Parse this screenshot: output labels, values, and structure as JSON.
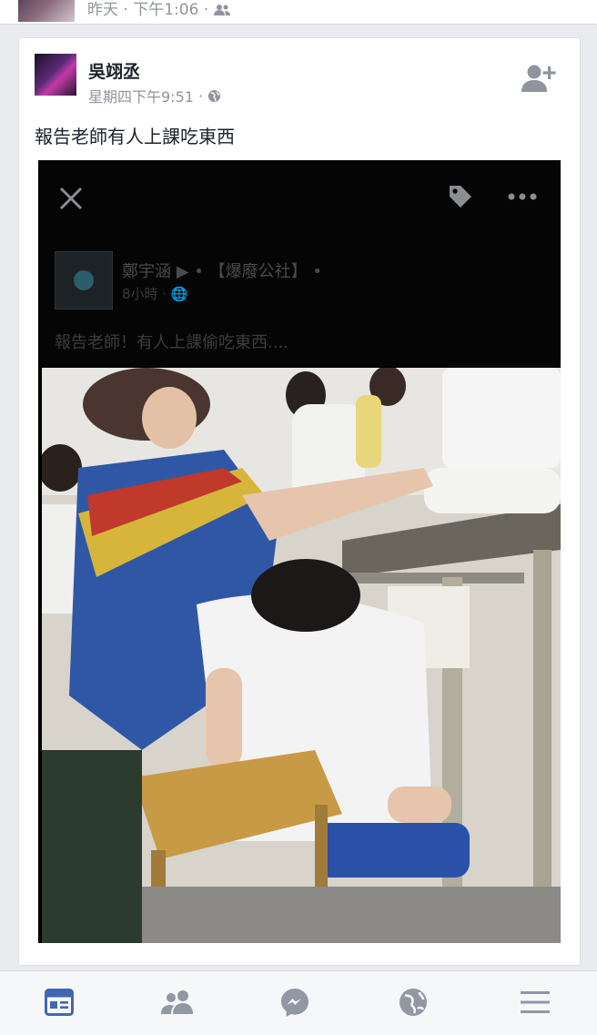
{
  "previous_post": {
    "meta": "昨天 · 下午1:06 ·"
  },
  "post": {
    "author": "吳翊丞",
    "timestamp": "星期四下午9:51",
    "separator": "·",
    "text": "報告老師有人上課吃東西"
  },
  "embedded": {
    "page_name": "鄭宇涵 ▶ • 【爆廢公社】 •",
    "time": "8小時 · 🌐",
    "caption": "報告老師！有人上課偷吃東西....",
    "icons": [
      "close-icon",
      "tag-icon",
      "more-dots-icon"
    ]
  },
  "tabbar": {
    "tabs": [
      {
        "name": "news-feed",
        "icon": "news-feed-icon",
        "active": true
      },
      {
        "name": "friends",
        "icon": "friends-icon",
        "active": false
      },
      {
        "name": "messenger",
        "icon": "messenger-icon",
        "active": false
      },
      {
        "name": "notifications",
        "icon": "globe-icon",
        "active": false
      },
      {
        "name": "menu",
        "icon": "menu-icon",
        "active": false
      }
    ]
  },
  "colors": {
    "accent": "#4267b2",
    "inactive": "#9197a3",
    "meta": "#90949c"
  }
}
